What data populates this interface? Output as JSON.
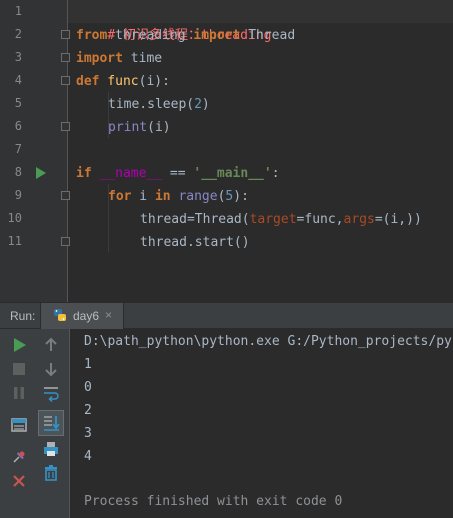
{
  "editor": {
    "line_numbers": [
      "1",
      "2",
      "3",
      "4",
      "5",
      "6",
      "7",
      "8",
      "9",
      "10",
      "11"
    ],
    "lines": {
      "l1": "# 初识多线程：threading",
      "l2": {
        "from": "from",
        "module": " threading ",
        "import": "import",
        "name": " Thread"
      },
      "l3": {
        "import": "import",
        "module": " time"
      },
      "l4": {
        "def": "def",
        "name": " func",
        "args": "(i):"
      },
      "l5": {
        "call": "time.sleep(",
        "num": "2",
        "close": ")"
      },
      "l6": {
        "call": "print",
        "args": "(i)"
      },
      "l8": {
        "if": "if",
        "dunder": " __name__",
        "op": " == ",
        "str": "'__main__'",
        "colon": ":"
      },
      "l9": {
        "for": "for",
        "var": " i ",
        "in": "in",
        "range": " range",
        "open": "(",
        "num": "5",
        "close": "):"
      },
      "l10": {
        "a": "thread=Thread(",
        "k1": "target",
        "b": "=func,",
        "k2": "args",
        "c": "=(i,))"
      },
      "l11": "thread.start()"
    }
  },
  "run_panel": {
    "label": "Run:",
    "tab_name": "day6",
    "close_glyph": "×",
    "command": "D:\\path_python\\python.exe G:/Python_projects/py",
    "output": [
      "1",
      "0",
      "2",
      "3",
      "4"
    ],
    "exit_message": "Process finished with exit code 0"
  },
  "toolbar": {
    "icons": [
      "run-icon",
      "stop-icon",
      "pause-icon",
      "up-icon",
      "down-icon",
      "soft-wrap-icon",
      "scroll-to-end-icon",
      "print-icon",
      "trash-icon",
      "layout-icon",
      "pin-icon",
      "close-icon"
    ],
    "colors": {
      "run": "#499c54",
      "close": "#c75450",
      "accent": "#3592c4"
    }
  }
}
